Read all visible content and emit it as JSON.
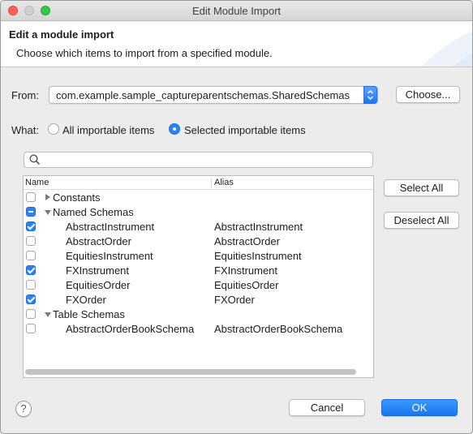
{
  "window": {
    "title": "Edit Module Import"
  },
  "header": {
    "title": "Edit a module import",
    "description": "Choose which items to import from a specified module."
  },
  "from": {
    "label": "From:",
    "value": "com.example.sample_captureparentschemas.SharedSchemas",
    "choose_label": "Choose..."
  },
  "what": {
    "label": "What:",
    "options": [
      {
        "label": "All importable items",
        "selected": false
      },
      {
        "label": "Selected importable items",
        "selected": true
      }
    ]
  },
  "search": {
    "value": "",
    "placeholder": ""
  },
  "tree": {
    "columns": {
      "name": "Name",
      "alias": "Alias"
    },
    "rows": [
      {
        "name": "Constants",
        "alias": "",
        "check": "unchecked",
        "expander": "collapsed"
      },
      {
        "name": "Named Schemas",
        "alias": "",
        "check": "mixed",
        "expander": "expanded"
      },
      {
        "name": "AbstractInstrument",
        "alias": "AbstractInstrument",
        "check": "checked"
      },
      {
        "name": "AbstractOrder",
        "alias": "AbstractOrder",
        "check": "unchecked"
      },
      {
        "name": "EquitiesInstrument",
        "alias": "EquitiesInstrument",
        "check": "unchecked"
      },
      {
        "name": "FXInstrument",
        "alias": "FXInstrument",
        "check": "checked"
      },
      {
        "name": "EquitiesOrder",
        "alias": "EquitiesOrder",
        "check": "unchecked"
      },
      {
        "name": "FXOrder",
        "alias": "FXOrder",
        "check": "checked"
      },
      {
        "name": "Table Schemas",
        "alias": "",
        "check": "unchecked",
        "expander": "expanded"
      },
      {
        "name": "AbstractOrderBookSchema",
        "alias": "AbstractOrderBookSchema",
        "check": "unchecked"
      }
    ]
  },
  "side_buttons": {
    "select_all": "Select All",
    "deselect_all": "Deselect All"
  },
  "footer": {
    "help": "?",
    "cancel": "Cancel",
    "ok": "OK"
  },
  "colors": {
    "accent": "#2b82f7",
    "close": "#fc605b",
    "maximize": "#34c84a"
  },
  "icons": [
    "help-icon",
    "search-icon",
    "stepper-icon",
    "expander-icon"
  ]
}
